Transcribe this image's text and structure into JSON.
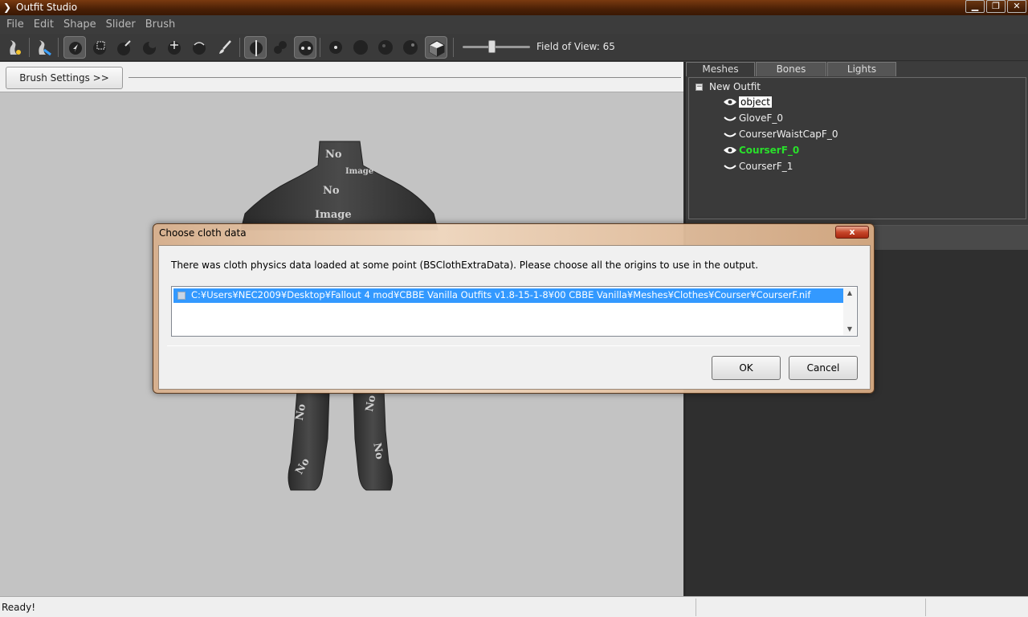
{
  "window": {
    "title": "Outfit Studio",
    "minimize": "▁",
    "maximize": "❐",
    "close": "✕"
  },
  "menu": [
    "File",
    "Edit",
    "Shape",
    "Slider",
    "Brush"
  ],
  "toolbar": {
    "fov_label": "Field of View: 65",
    "fov_value": 65,
    "pressed_tools": [
      "select-tool",
      "mirror-tool",
      "connected-tool"
    ]
  },
  "left_pane": {
    "brush_settings_label": "Brush Settings >>"
  },
  "right_pane": {
    "tabs": [
      "Meshes",
      "Bones",
      "Lights"
    ],
    "active_tab": "Meshes",
    "tree": {
      "root": "New Outfit",
      "items": [
        {
          "label": "object",
          "visible": true,
          "selected": true
        },
        {
          "label": "GloveF_0",
          "visible": false
        },
        {
          "label": "CourserWaistCapF_0",
          "visible": false
        },
        {
          "label": "CourserF_0",
          "visible": true,
          "active": true
        },
        {
          "label": "CourserF_1",
          "visible": false
        }
      ]
    }
  },
  "dialog": {
    "title": "Choose cloth data",
    "close": "x",
    "message": "There was cloth physics data loaded at some point (BSClothExtraData). Please choose all the origins to use in the output.",
    "list_items": [
      "C:¥Users¥NEC2009¥Desktop¥Fallout 4 mod¥CBBE Vanilla Outfits v1.8-15-1-8¥00 CBBE Vanilla¥Meshes¥Clothes¥Courser¥CourserF.nif"
    ],
    "ok_label": "OK",
    "cancel_label": "Cancel"
  },
  "status": {
    "text": "Ready!"
  },
  "colors": {
    "active_mesh": "#29e02b",
    "selection": "#3399ff",
    "viewport_bg": "#c3c3c3"
  }
}
